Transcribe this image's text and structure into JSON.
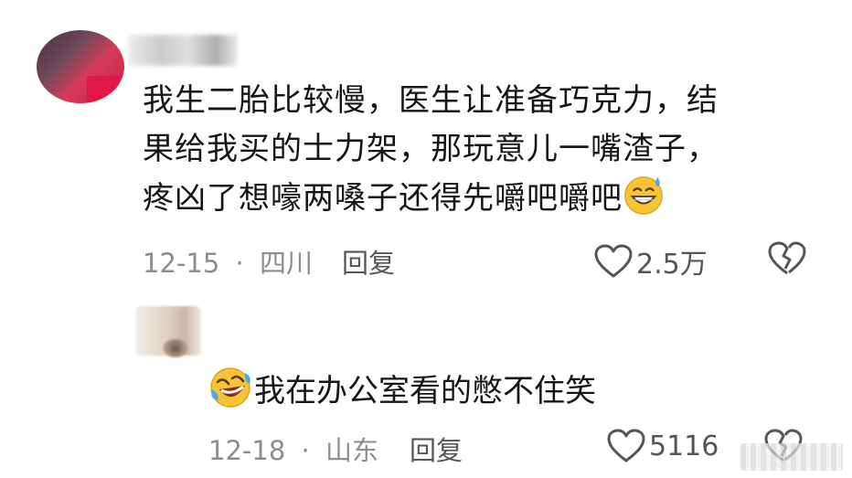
{
  "comments": [
    {
      "text_line1": "我生二胎比较慢，医生让准备巧克力，结",
      "text_line2": "果给我买的士力架，那玩意儿一嘴渣子，",
      "text_line3": "疼凶了想嚎两嗓子还得先嚼吧嚼吧",
      "emoji": "grinning-sweat-emoji",
      "date": "12-15",
      "separator": "·",
      "location": "四川",
      "reply_label": "回复",
      "likes": "2.5万",
      "like_icon": "heart-outline-icon",
      "dislike_icon": "broken-heart-icon"
    }
  ],
  "reply": {
    "emoji": "rolling-laughing-emoji",
    "text": "我在办公室看的憋不住笑",
    "date": "12-18",
    "separator": "·",
    "location": "山东",
    "reply_label": "回复",
    "likes": "5116",
    "like_icon": "heart-outline-icon",
    "dislike_icon": "broken-heart-icon"
  },
  "colors": {
    "text": "#161616",
    "meta": "#8d8d8d",
    "action": "#555555",
    "emoji_yellow": "#f7c534"
  }
}
